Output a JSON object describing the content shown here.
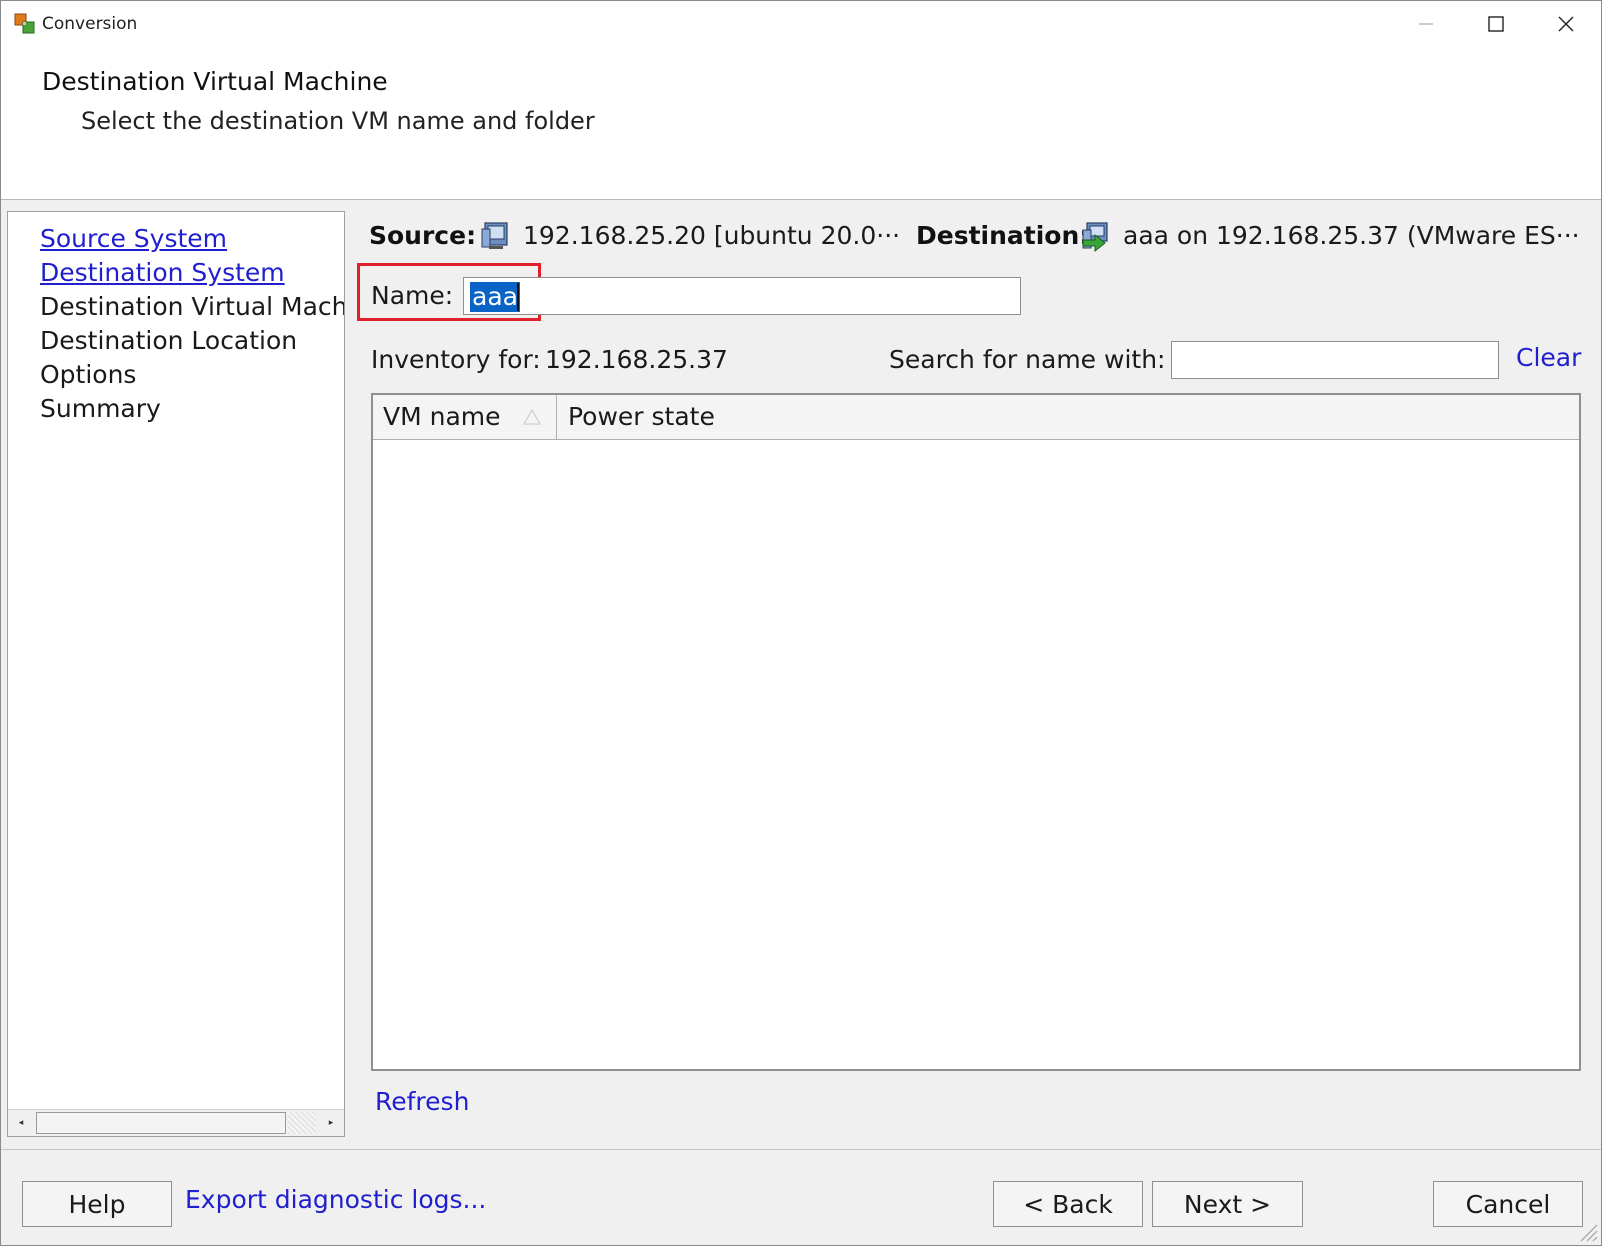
{
  "window": {
    "title": "Conversion"
  },
  "header": {
    "title": "Destination Virtual Machine",
    "subtitle": "Select the destination VM name and folder"
  },
  "nav": {
    "items": [
      {
        "label": "Source System",
        "state": "link"
      },
      {
        "label": "Destination System",
        "state": "link"
      },
      {
        "label": "Destination Virtual Mach",
        "state": "current"
      },
      {
        "label": "Destination Location",
        "state": "pending"
      },
      {
        "label": "Options",
        "state": "pending"
      },
      {
        "label": "Summary",
        "state": "pending"
      }
    ]
  },
  "summary": {
    "source_label": "Source:",
    "source_value": "192.168.25.20 [ubuntu 20.0···",
    "destination_label": "Destination:",
    "destination_value": "aaa on 192.168.25.37 (VMware ES···"
  },
  "name_field": {
    "label": "Name:",
    "value": "aaa"
  },
  "inventory": {
    "label": "Inventory for:",
    "host": "192.168.25.37",
    "search_label": "Search for name with:",
    "search_value": "",
    "clear_label": "Clear",
    "columns": [
      "VM name",
      "Power state"
    ],
    "rows": [],
    "refresh_label": "Refresh"
  },
  "footer": {
    "help": "Help",
    "export": "Export diagnostic logs...",
    "back": "< Back",
    "next": "Next >",
    "cancel": "Cancel"
  },
  "colors": {
    "link": "#1f1fcf",
    "highlight": "#e0202a",
    "selection": "#0a64c8"
  }
}
